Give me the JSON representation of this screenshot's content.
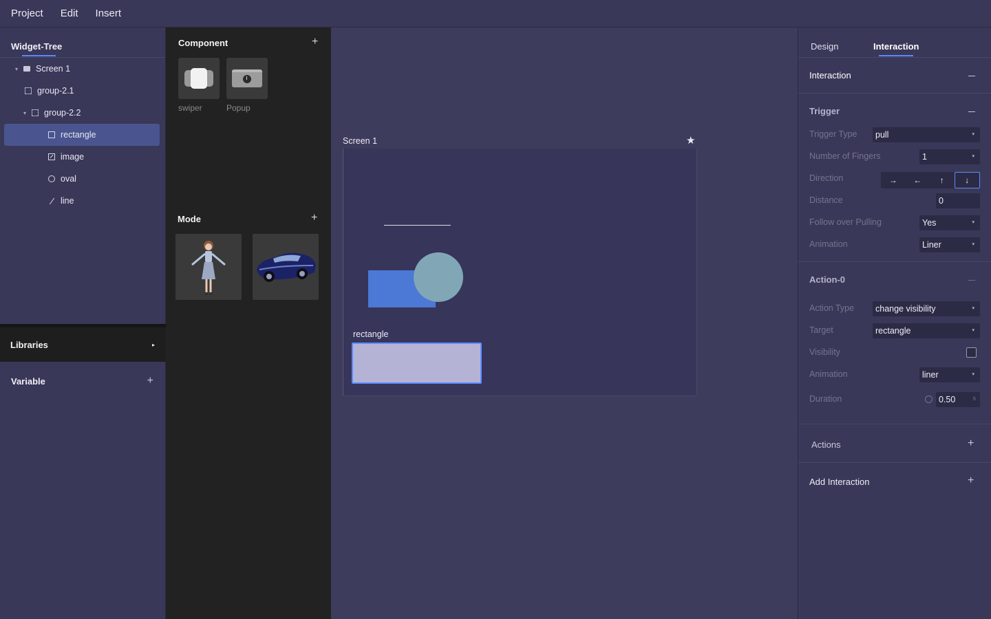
{
  "menu": {
    "items": [
      "Project",
      "Edit",
      "Insert"
    ]
  },
  "left": {
    "widget_tree_title": "Widget-Tree",
    "tree": [
      {
        "label": "Screen 1",
        "icon": "screen-icon",
        "caret": "▾"
      },
      {
        "label": "group-2.1",
        "icon": "group-icon",
        "caret": ""
      },
      {
        "label": "group-2.2",
        "icon": "group-icon",
        "caret": "▾"
      },
      {
        "label": "rectangle",
        "icon": "rectangle-icon",
        "caret": ""
      },
      {
        "label": "image",
        "icon": "image-icon",
        "caret": ""
      },
      {
        "label": "oval",
        "icon": "oval-icon",
        "caret": ""
      },
      {
        "label": "line",
        "icon": "line-icon",
        "caret": ""
      }
    ],
    "selected_item": "rectangle",
    "libraries_label": "Libraries",
    "libraries_arrow": "▸",
    "variable_label": "Variable",
    "plus": "+"
  },
  "components": {
    "title": "Component",
    "plus": "+",
    "items": [
      {
        "label": "swiper",
        "icon": "swiper-icon"
      },
      {
        "label": "Popup",
        "icon": "popup-icon"
      }
    ],
    "mode_title": "Mode",
    "mode_items": [
      {
        "icon": "character-model-icon"
      },
      {
        "icon": "car-model-icon"
      }
    ]
  },
  "canvas": {
    "screen_label": "Screen 1",
    "star": "★",
    "selected_label": "rectangle",
    "colors": {
      "rect": "#4c78d6",
      "oval": "#81a7b6",
      "selected_rect": "#b4b3d6",
      "selection": "#5c8bff"
    }
  },
  "right": {
    "tabs": [
      "Design",
      "Interaction"
    ],
    "active_tab": "Interaction",
    "interaction_title": "Interaction",
    "trigger": {
      "title": "Trigger",
      "trigger_type_label": "Trigger Type",
      "trigger_type_value": "pull",
      "fingers_label": "Number of Fingers",
      "fingers_value": "1",
      "direction_label": "Direction",
      "directions": [
        "→",
        "←",
        "↑",
        "↓"
      ],
      "active_direction": "↓",
      "distance_label": "Distance",
      "distance_value": "0",
      "follow_label": "Follow over Pulling",
      "follow_value": "Yes",
      "animation_label": "Animation",
      "animation_value": "Liner"
    },
    "action": {
      "title": "Action-0",
      "action_type_label": "Action Type",
      "action_type_value": "change visibility",
      "target_label": "Target",
      "target_value": "rectangle",
      "visibility_label": "Visibility",
      "visibility_checked": false,
      "animation_label": "Animation",
      "animation_value": "liner",
      "duration_label": "Duration",
      "duration_value": "0.50",
      "duration_unit": "s"
    },
    "actions_label": "Actions",
    "add_interaction_label": "Add Interaction",
    "arrow": "▾",
    "plus": "+"
  }
}
